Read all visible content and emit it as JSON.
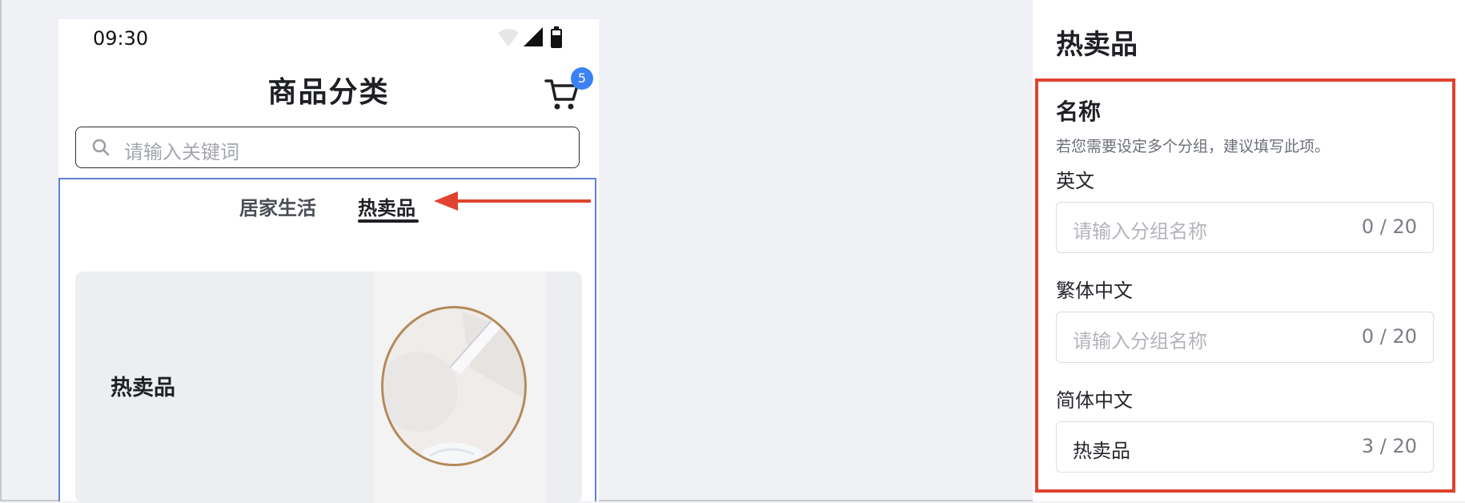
{
  "phone": {
    "status_time": "09:30",
    "nav_title": "商品分类",
    "cart_badge": "5",
    "search_placeholder": "请输入关键词",
    "tabs": [
      {
        "label": "居家生活",
        "active": false
      },
      {
        "label": "热卖品",
        "active": true
      }
    ],
    "card_title": "热卖品"
  },
  "panel": {
    "title": "热卖品",
    "section_label": "名称",
    "section_hint": "若您需要设定多个分组，建议填写此项。",
    "fields": [
      {
        "label": "英文",
        "placeholder": "请输入分组名称",
        "value": "",
        "count": "0 / 20"
      },
      {
        "label": "繁体中文",
        "placeholder": "请输入分组名称",
        "value": "",
        "count": "0 / 20"
      },
      {
        "label": "简体中文",
        "placeholder": "请输入分组名称",
        "value": "热卖品",
        "count": "3 / 20"
      }
    ]
  },
  "colors": {
    "annotation_red": "#e0432f",
    "highlight_blue": "#5d82d6",
    "badge_blue": "#3b82f6"
  }
}
